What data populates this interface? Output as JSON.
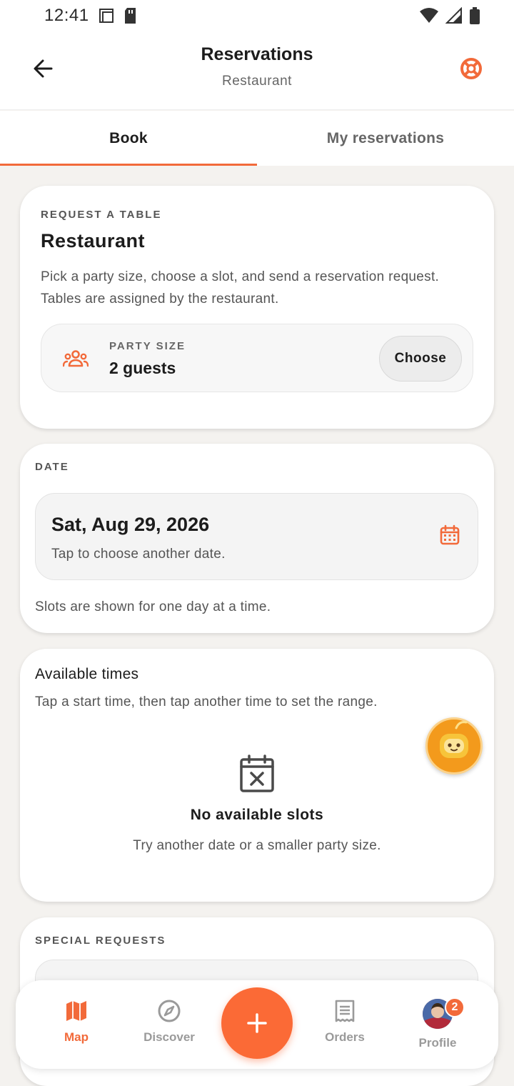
{
  "status_bar": {
    "time": "12:41"
  },
  "header": {
    "title": "Reservations",
    "subtitle": "Restaurant"
  },
  "tabs": [
    {
      "label": "Book",
      "active": true
    },
    {
      "label": "My reservations",
      "active": false
    }
  ],
  "request_card": {
    "eyebrow": "REQUEST A TABLE",
    "title": "Restaurant",
    "description": "Pick a party size, choose a slot, and send a reservation request. Tables are assigned by the restaurant.",
    "party_size_label": "PARTY SIZE",
    "party_size_value": "2 guests",
    "choose_label": "Choose"
  },
  "date_card": {
    "eyebrow": "DATE",
    "date_value": "Sat, Aug 29, 2026",
    "date_hint": "Tap to choose another date.",
    "note": "Slots are shown for one day at a time."
  },
  "times_card": {
    "title": "Available times",
    "description": "Tap a start time, then tap another time to set the range.",
    "empty_title": "No available slots",
    "empty_description": "Try another date or a smaller party size."
  },
  "requests_card": {
    "eyebrow": "SPECIAL REQUESTS"
  },
  "bottom_nav": {
    "items": [
      {
        "label": "Map",
        "icon": "map-icon",
        "active": true
      },
      {
        "label": "Discover",
        "icon": "compass-icon",
        "active": false
      },
      {
        "label": "Orders",
        "icon": "receipt-icon",
        "active": false
      },
      {
        "label": "Profile",
        "icon": "avatar",
        "active": false
      }
    ],
    "profile_badge": "2"
  },
  "colors": {
    "accent": "#f26a3a",
    "fab": "#fb6a36",
    "background": "#f4f2ef"
  }
}
